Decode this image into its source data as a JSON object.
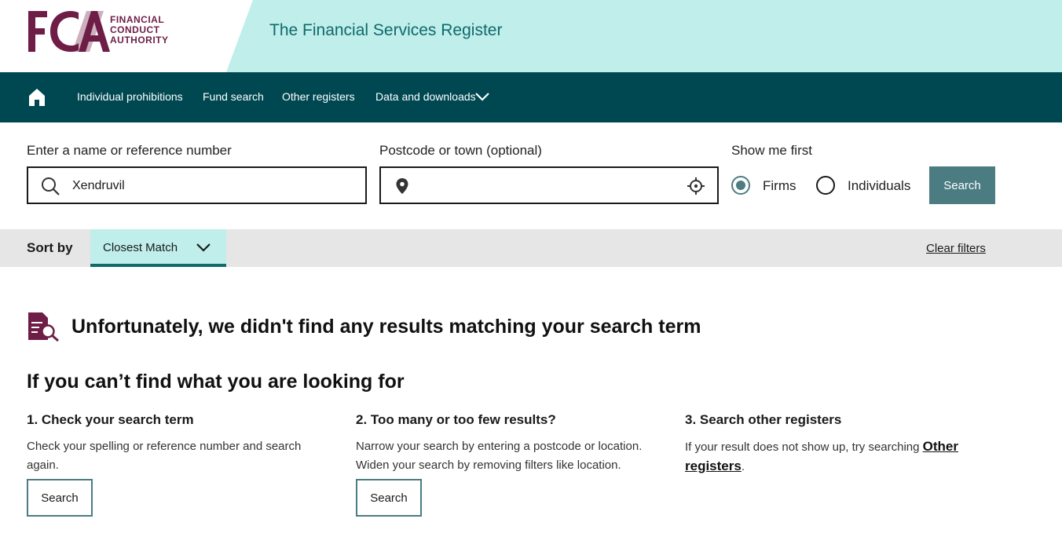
{
  "brand": {
    "logo_alt": "FCA",
    "logo_lines": [
      "FINANCIAL",
      "CONDUCT",
      "AUTHORITY"
    ],
    "site_title": "The Financial Services Register"
  },
  "nav": {
    "home_icon": "home-icon",
    "items": [
      "Individual prohibitions",
      "Fund search",
      "Other registers",
      "Data and downloads"
    ],
    "dropdown_icon": "chevron-down-icon"
  },
  "search": {
    "name_label": "Enter a name or reference number",
    "name_value": "Xendruvil",
    "postcode_label": "Postcode or town (optional)",
    "postcode_value": "",
    "show_first_label": "Show me first",
    "option_firms": "Firms",
    "option_individuals": "Individuals",
    "selected": "Firms",
    "button_label": "Search"
  },
  "sort": {
    "label": "Sort by",
    "value": "Closest Match",
    "clear_label": "Clear filters"
  },
  "results": {
    "no_results_message": "Unfortunately, we didn't find any results matching your search term",
    "help_title": "If you can’t find what you are looking for",
    "columns": [
      {
        "title": "1. Check your search term",
        "text": "Check your spelling or reference number and search again.",
        "button": "Search"
      },
      {
        "title": "2. Too many or too few results?",
        "text_line1": "Narrow your search by entering a postcode or location.",
        "text_line2": "Widen your search by removing filters like location.",
        "button": "Search"
      },
      {
        "title": "3. Search other registers",
        "text_prefix": "If your result does not show up, try searching ",
        "link": "Other registers",
        "text_suffix": "."
      }
    ]
  },
  "colors": {
    "brand_maroon": "#6e1e46",
    "header_band": "#bfeeeb",
    "nav_bg": "#004851",
    "accent_teal": "#4a7c82"
  }
}
